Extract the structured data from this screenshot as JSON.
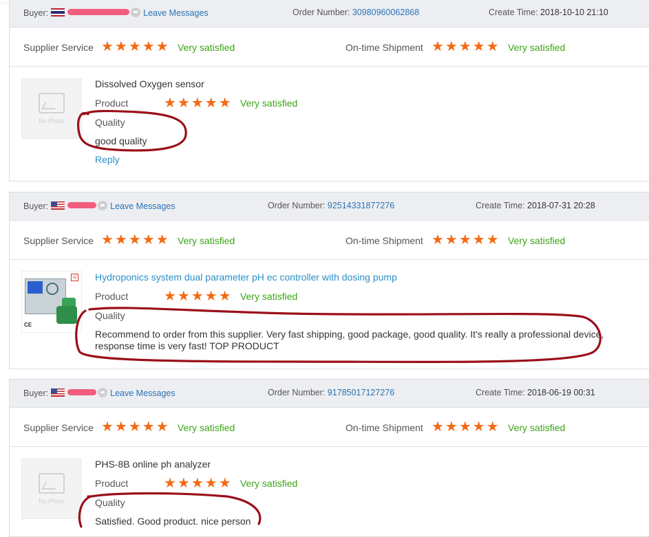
{
  "reviews": [
    {
      "buyer_label": "Buyer:",
      "leave_messages": "Leave Messages",
      "order_number_label": "Order Number:",
      "order_number": "30980960062868",
      "create_time_label": "Create Time:",
      "create_time": "2018-10-10 21:10",
      "supplier_service_label": "Supplier Service",
      "supplier_service_rating": "Very satisfied",
      "ontime_label": "On-time Shipment",
      "ontime_rating": "Very satisfied",
      "product_name": "Dissolved Oxygen sensor",
      "product_label": "Product",
      "product_rating": "Very satisfied",
      "quality_label": "Quality",
      "comment": "good quality",
      "reply": "Reply",
      "no_photo": "No Photo",
      "stars": 5
    },
    {
      "buyer_label": "Buyer:",
      "leave_messages": "Leave Messages",
      "order_number_label": "Order Number:",
      "order_number": "92514331877276",
      "create_time_label": "Create Time:",
      "create_time": "2018-07-31 20:28",
      "supplier_service_label": "Supplier Service",
      "supplier_service_rating": "Very satisfied",
      "ontime_label": "On-time Shipment",
      "ontime_rating": "Very satisfied",
      "product_name": "Hydroponics system dual parameter pH ec controller with dosing pump",
      "product_label": "Product",
      "product_rating": "Very satisfied",
      "quality_label": "Quality",
      "comment_line1": "Recommend to order from this supplier. Very fast shipping, good package, good quality. It's really a professional device,",
      "comment_line2": "response time is very fast! TOP PRODUCT",
      "thumb_mark": "CE",
      "stars": 5
    },
    {
      "buyer_label": "Buyer:",
      "leave_messages": "Leave Messages",
      "order_number_label": "Order Number:",
      "order_number": "91785017127276",
      "create_time_label": "Create Time:",
      "create_time": "2018-06-19 00:31",
      "supplier_service_label": "Supplier Service",
      "supplier_service_rating": "Very satisfied",
      "ontime_label": "On-time Shipment",
      "ontime_rating": "Very satisfied",
      "product_name": "PHS-8B online ph analyzer",
      "product_label": "Product",
      "product_rating": "Very satisfied",
      "quality_label": "Quality",
      "comment": "Satisfied. Good product. nice person",
      "no_photo": "No Photo",
      "stars": 5
    }
  ],
  "colors": {
    "star": "#f26a14",
    "satisfied": "#3aa415",
    "link": "#2b73b6",
    "header_bg": "#eceef1",
    "annotation_ink": "#9a0f19"
  }
}
